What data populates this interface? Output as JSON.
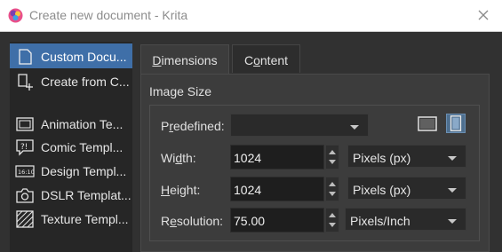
{
  "window": {
    "title": "Create new document - Krita"
  },
  "sidebar": {
    "items": [
      {
        "label": "Custom Docu...",
        "icon": "document-icon",
        "selected": true
      },
      {
        "label": "Create from C...",
        "icon": "new-from-clipboard-icon",
        "selected": false
      },
      {
        "label": "Animation Te...",
        "icon": "animation-template-icon",
        "selected": false
      },
      {
        "label": "Comic Templ...",
        "icon": "comic-template-icon",
        "selected": false
      },
      {
        "label": "Design Templ...",
        "icon": "design-template-icon",
        "selected": false
      },
      {
        "label": "DSLR Templat...",
        "icon": "camera-icon",
        "selected": false
      },
      {
        "label": "Texture Templ...",
        "icon": "texture-template-icon",
        "selected": false
      }
    ]
  },
  "tabs": [
    {
      "label": "Dimensions",
      "mnemonic": "D",
      "rest": "imensions",
      "active": true
    },
    {
      "label": "Content",
      "mnemonic": "o",
      "pre": "C",
      "rest": "ntent",
      "active": false
    }
  ],
  "image_size": {
    "group_title": "Image Size",
    "predefined": {
      "label_pre": "P",
      "label_mn": "r",
      "label_rest": "edefined:",
      "value": ""
    },
    "width": {
      "label_pre": "Wi",
      "label_mn": "d",
      "label_rest": "th:",
      "value": "1024",
      "unit": "Pixels (px)"
    },
    "height": {
      "label_mn": "H",
      "label_rest": "eight:",
      "value": "1024",
      "unit": "Pixels (px)"
    },
    "resolution": {
      "label_pre": "R",
      "label_mn": "e",
      "label_rest": "solution:",
      "value": "75.00",
      "unit": "Pixels/Inch"
    },
    "orientation": {
      "selected": "portrait"
    }
  },
  "colors": {
    "accent": "#3f6fa8",
    "window_bg": "#313131"
  }
}
